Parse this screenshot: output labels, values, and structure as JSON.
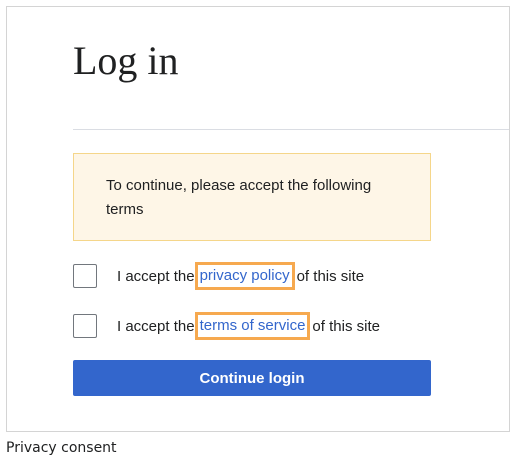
{
  "page": {
    "title": "Log in"
  },
  "notice": {
    "text": "To continue, please accept the following terms"
  },
  "terms": [
    {
      "prefix": "I accept the",
      "link": "privacy policy",
      "suffix": "of this site",
      "checked": false
    },
    {
      "prefix": "I accept the",
      "link": "terms of service",
      "suffix": "of this site",
      "checked": false
    }
  ],
  "actions": {
    "continue_label": "Continue login"
  },
  "caption": "Privacy consent",
  "colors": {
    "link": "#3366cc",
    "button": "#3366cc",
    "notice_bg": "#fef6e7",
    "highlight": "#f6a94f"
  }
}
